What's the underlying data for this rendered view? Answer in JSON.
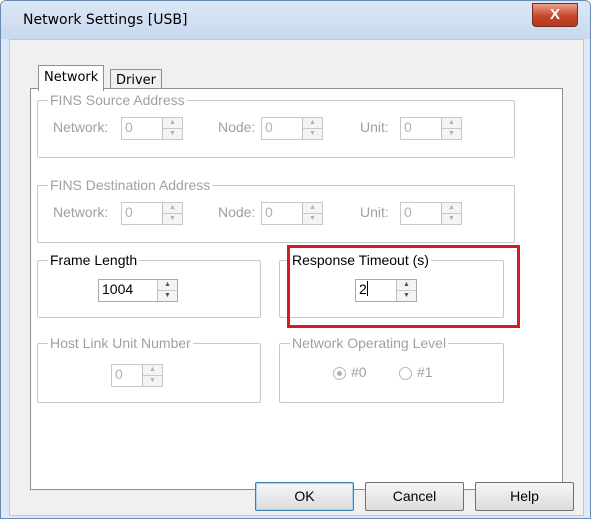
{
  "window": {
    "title": "Network Settings [USB]",
    "close_glyph": "X"
  },
  "tabs": [
    {
      "label": "Network",
      "selected": true
    },
    {
      "label": "Driver",
      "selected": false
    }
  ],
  "fins_source": {
    "title": "FINS Source Address",
    "network_label": "Network:",
    "network_value": "0",
    "node_label": "Node:",
    "node_value": "0",
    "unit_label": "Unit:",
    "unit_value": "0"
  },
  "fins_destination": {
    "title": "FINS Destination Address",
    "network_label": "Network:",
    "network_value": "0",
    "node_label": "Node:",
    "node_value": "0",
    "unit_label": "Unit:",
    "unit_value": "0"
  },
  "frame_length": {
    "title": "Frame Length",
    "value": "1004"
  },
  "response_timeout": {
    "title": "Response Timeout (s)",
    "value": "2"
  },
  "host_link": {
    "title": "Host Link Unit Number",
    "value": "0"
  },
  "network_level": {
    "title": "Network Operating Level",
    "option0": "#0",
    "option1": "#1",
    "selected": "#0"
  },
  "buttons": {
    "ok": "OK",
    "cancel": "Cancel",
    "help": "Help"
  },
  "colors": {
    "highlight": "#d71921",
    "disabled_text": "#a0a0a0"
  }
}
